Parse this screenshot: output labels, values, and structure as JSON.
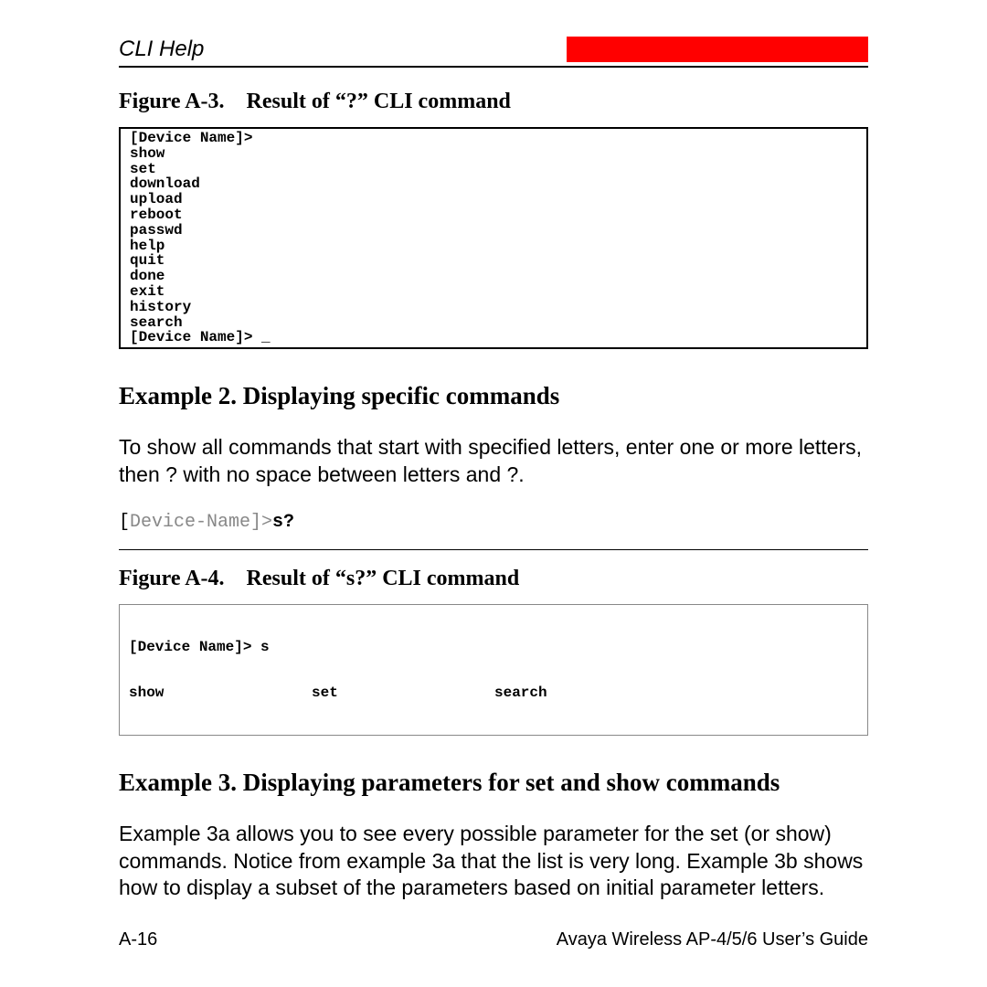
{
  "header": {
    "title": "CLI Help"
  },
  "figureA3": {
    "caption_prefix": "Figure A-3.",
    "caption_text": "Result of “?” CLI command",
    "lines": "[Device Name]>\nshow\nset\ndownload\nupload\nreboot\npasswd\nhelp\nquit\ndone\nexit\nhistory\nsearch\n[Device Name]> _"
  },
  "example2": {
    "heading": "Example 2. Displaying specific commands",
    "body": "To show all commands that start with specified letters, enter one or more letters, then ? with no space between letters and ?.",
    "code_prompt": "[Device-Name]>",
    "code_cmd": "s?"
  },
  "figureA4": {
    "caption_prefix": "Figure A-4.",
    "caption_text": "Result of “s?” CLI command",
    "line1": "[Device Name]> s",
    "col1": "show",
    "col2": "set",
    "col3": "search"
  },
  "example3": {
    "heading": "Example 3. Displaying parameters for set and show commands",
    "body": "Example 3a allows you to see every possible parameter for the set (or show) commands. Notice from example 3a that the list is very long. Example 3b shows how to display a subset of the parameters based on initial parameter letters."
  },
  "footer": {
    "left": "A-16",
    "right": "Avaya Wireless AP-4/5/6 User’s Guide"
  }
}
